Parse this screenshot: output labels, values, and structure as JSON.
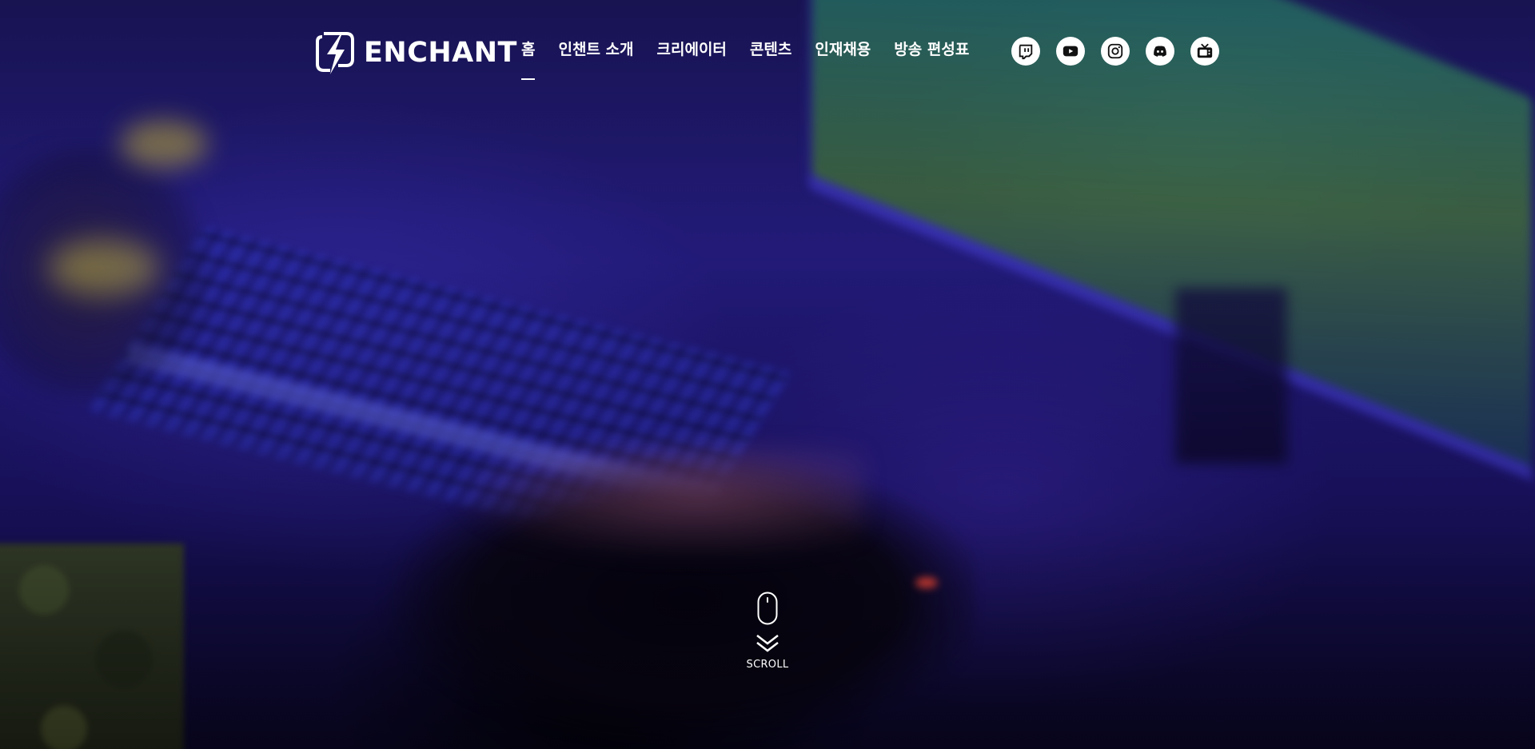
{
  "brand": {
    "name": "ENCHANT"
  },
  "nav": {
    "items": [
      {
        "label": "홈",
        "active": true
      },
      {
        "label": "인챈트 소개",
        "active": false
      },
      {
        "label": "크리에이터",
        "active": false
      },
      {
        "label": "콘텐츠",
        "active": false
      },
      {
        "label": "인재채용",
        "active": false
      },
      {
        "label": "방송 편성표",
        "active": false
      }
    ]
  },
  "socials": [
    {
      "icon": "twitch-icon"
    },
    {
      "icon": "youtube-icon"
    },
    {
      "icon": "instagram-icon"
    },
    {
      "icon": "discord-icon"
    },
    {
      "icon": "tv-icon"
    }
  ],
  "scroll": {
    "label": "SCROLL"
  },
  "colors": {
    "text": "#ffffff",
    "bg_tint": "#221a78"
  }
}
